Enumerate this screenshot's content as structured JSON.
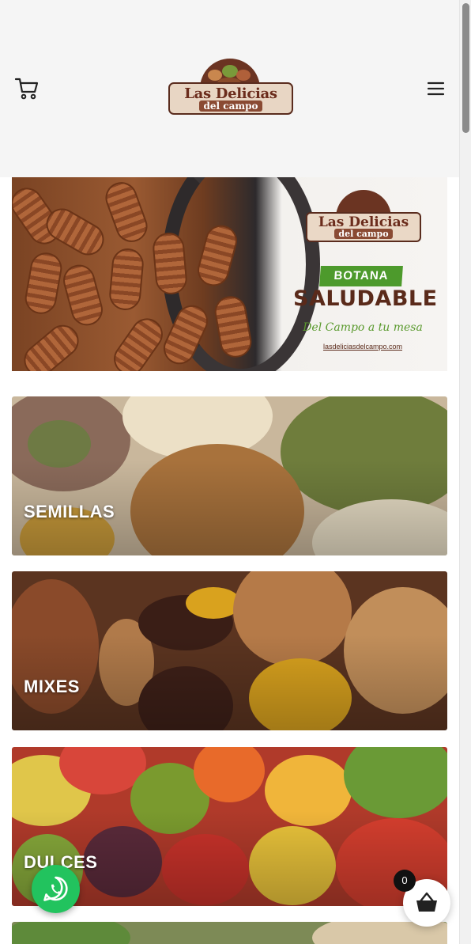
{
  "header": {
    "logo": {
      "line1": "Las Delicias",
      "line2": "del campo"
    }
  },
  "hero": {
    "logo": {
      "line1": "Las Delicias",
      "line2": "del campo"
    },
    "badge": "BOTANA",
    "headline": "SALUDABLE",
    "tagline": "Del Campo a tu mesa",
    "url": "lasdeliciasdelcampo.com"
  },
  "categories": [
    {
      "label": "SEMILLAS"
    },
    {
      "label": "MIXES"
    },
    {
      "label": "DULCES"
    }
  ],
  "cart": {
    "count": "0"
  },
  "colors": {
    "whatsapp": "#22c35e",
    "brand_brown": "#6b2c1c",
    "brand_green": "#4d9a2c"
  },
  "icons": [
    "cart-icon",
    "menu-icon",
    "whatsapp-icon",
    "basket-icon"
  ]
}
